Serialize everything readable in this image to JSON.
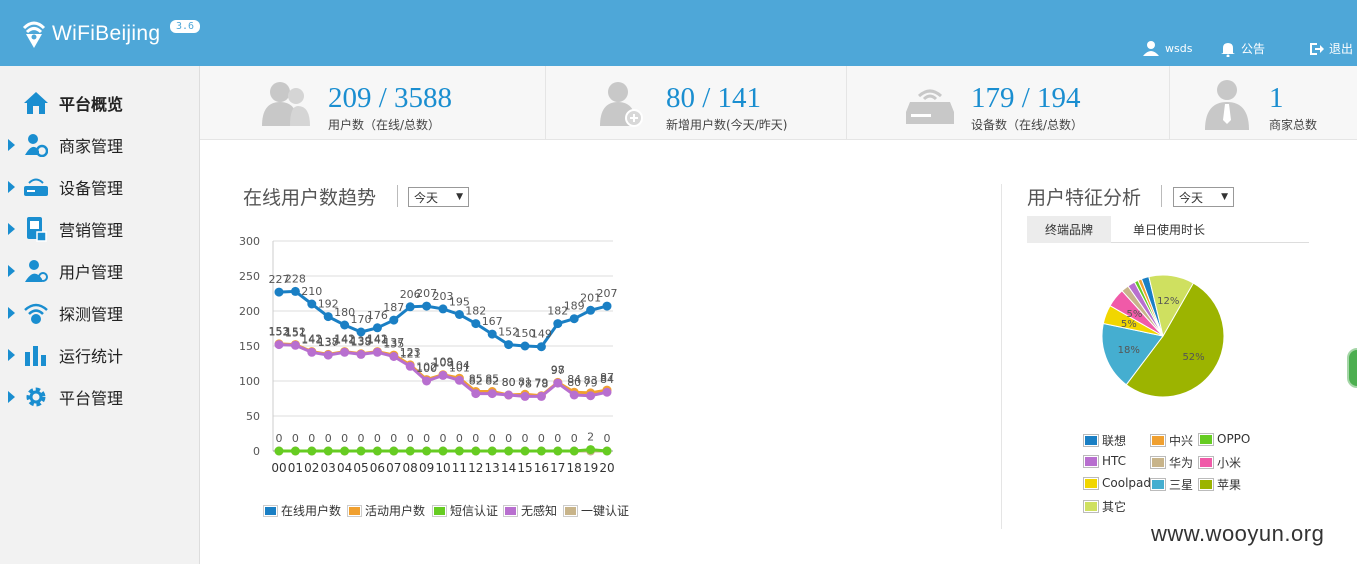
{
  "app": {
    "name": "WiFiBeijing",
    "version": "3.6"
  },
  "topnav": {
    "user": "wsds",
    "notice": "公告",
    "logout": "退出"
  },
  "sidebar": {
    "items": [
      {
        "label": "平台概览",
        "icon": "home-icon",
        "active": true
      },
      {
        "label": "商家管理",
        "icon": "merchant-icon"
      },
      {
        "label": "设备管理",
        "icon": "router-icon"
      },
      {
        "label": "营销管理",
        "icon": "marketing-icon"
      },
      {
        "label": "用户管理",
        "icon": "user-icon"
      },
      {
        "label": "探测管理",
        "icon": "wifi-icon"
      },
      {
        "label": "运行统计",
        "icon": "bar-chart-icon"
      },
      {
        "label": "平台管理",
        "icon": "gear-icon"
      }
    ]
  },
  "stats": [
    {
      "value": "209 / 3588",
      "label": "用户数（在线/总数）",
      "icon": "users-icon"
    },
    {
      "value": "80 / 141",
      "label": "新增用户数(今天/昨天)",
      "icon": "add-user-icon"
    },
    {
      "value": "179 / 194",
      "label": "设备数（在线/总数）",
      "icon": "device-icon"
    },
    {
      "value": "1",
      "label": "商家总数",
      "icon": "merchant-person-icon"
    }
  ],
  "trend": {
    "title": "在线用户数趋势",
    "select": "今天"
  },
  "features": {
    "title": "用户特征分析",
    "select": "今天",
    "tabs": [
      "终端品牌",
      "单日使用时长"
    ]
  },
  "chart_data": [
    {
      "type": "line",
      "categories": [
        "00",
        "01",
        "02",
        "03",
        "04",
        "05",
        "06",
        "07",
        "08",
        "09",
        "10",
        "11",
        "12",
        "13",
        "14",
        "15",
        "16",
        "17",
        "18",
        "19",
        "20"
      ],
      "ylim": [
        0,
        300
      ],
      "yticks": [
        0,
        50,
        100,
        150,
        200,
        250,
        300
      ],
      "grid": true,
      "legend_position": "bottom",
      "series": [
        {
          "name": "在线用户数",
          "color": "#1a7fc4",
          "values": [
            227,
            228,
            210,
            192,
            180,
            170,
            176,
            187,
            206,
            207,
            203,
            195,
            182,
            167,
            152,
            150,
            149,
            182,
            189,
            201,
            207
          ]
        },
        {
          "name": "活动用户数",
          "color": "#f0a030",
          "values": [
            153,
            152,
            142,
            138,
            142,
            139,
            142,
            137,
            123,
            102,
            109,
            104,
            85,
            85,
            80,
            81,
            79,
            98,
            84,
            83,
            87
          ]
        },
        {
          "name": "短信认证",
          "color": "#66cc22",
          "values": [
            0,
            0,
            0,
            0,
            0,
            0,
            0,
            0,
            0,
            0,
            0,
            0,
            0,
            0,
            0,
            0,
            0,
            0,
            0,
            2,
            0
          ]
        },
        {
          "name": "无感知",
          "color": "#b86fcf",
          "values": [
            152,
            151,
            141,
            137,
            141,
            138,
            141,
            135,
            121,
            100,
            108,
            101,
            82,
            82,
            80,
            78,
            78,
            97,
            80,
            79,
            84
          ]
        },
        {
          "name": "一键认证",
          "color": "#c8b48a",
          "values": [
            0,
            0,
            0,
            0,
            0,
            0,
            0,
            0,
            0,
            0,
            0,
            0,
            0,
            0,
            0,
            0,
            0,
            0,
            0,
            0,
            0
          ]
        }
      ]
    },
    {
      "type": "pie",
      "slices": [
        {
          "name": "苹果",
          "value": 52,
          "color": "#9cb400",
          "label": "52%"
        },
        {
          "name": "三星",
          "value": 18,
          "color": "#45aed0",
          "label": "18%"
        },
        {
          "name": "Coolpad",
          "value": 5,
          "color": "#f1d600",
          "label": "5%"
        },
        {
          "name": "小米",
          "value": 5,
          "color": "#f05aa8",
          "label": "5%"
        },
        {
          "name": "华为",
          "value": 2,
          "color": "#c8b48a",
          "label": ""
        },
        {
          "name": "HTC",
          "value": 2,
          "color": "#b86fcf",
          "label": ""
        },
        {
          "name": "OPPO",
          "value": 1,
          "color": "#66cc22",
          "label": ""
        },
        {
          "name": "中兴",
          "value": 1,
          "color": "#f0a030",
          "label": ""
        },
        {
          "name": "联想",
          "value": 2,
          "color": "#1a7fc4",
          "label": ""
        },
        {
          "name": "其它",
          "value": 12,
          "color": "#cfe060",
          "label": "12%"
        }
      ],
      "legend": [
        "联想",
        "中兴",
        "OPPO",
        "HTC",
        "华为",
        "小米",
        "Coolpad",
        "三星",
        "苹果",
        "其它"
      ]
    }
  ],
  "watermark": "www.wooyun.org"
}
